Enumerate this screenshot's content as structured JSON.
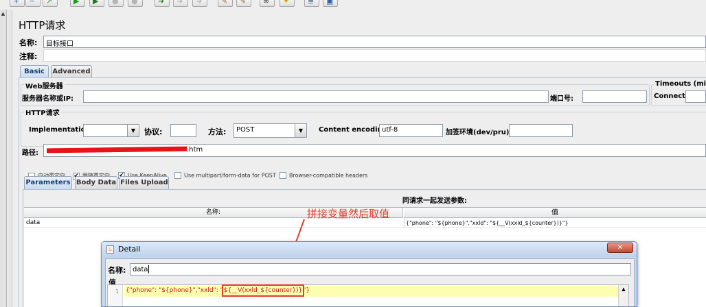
{
  "toolbar": {
    "buttons": [
      {
        "icon": "plus-icon",
        "glyph": "+",
        "color": "#2a5fa8"
      },
      {
        "icon": "minus-icon",
        "glyph": "−",
        "color": "#2a5fa8"
      },
      {
        "icon": "expand-icon",
        "glyph": "↗",
        "color": "#2a8a2a"
      },
      {
        "icon": "start-icon",
        "glyph": "▶",
        "color": "#1f9a1f"
      },
      {
        "icon": "start-no-pause-icon",
        "glyph": "▶",
        "color": "#1f7a1f"
      },
      {
        "icon": "stop-icon",
        "glyph": "●",
        "color": "#b5b5b5"
      },
      {
        "icon": "shutdown-icon",
        "glyph": "●",
        "color": "#b5b5b5"
      },
      {
        "icon": "remote-start-icon",
        "glyph": "➜",
        "color": "#2a8a2a"
      },
      {
        "icon": "remote-stop-icon",
        "glyph": "➜",
        "color": "#b5b5b5"
      },
      {
        "icon": "remote-exit-icon",
        "glyph": "➜",
        "color": "#b5b5b5"
      },
      {
        "icon": "clear-icon",
        "glyph": "✎",
        "color": "#b06020"
      },
      {
        "icon": "clear-all-icon",
        "glyph": "✎",
        "color": "#8a5a30"
      },
      {
        "icon": "search-binoculars-icon",
        "glyph": "∞",
        "color": "#222222"
      },
      {
        "icon": "reset-search-icon",
        "glyph": "✦",
        "color": "#d8a400"
      },
      {
        "icon": "function-helper-icon",
        "glyph": "≣",
        "color": "#3c5f8a"
      },
      {
        "icon": "help-icon",
        "glyph": "▣",
        "color": "#2a5fa8"
      }
    ]
  },
  "sidebar": {
    "scroll_up_glyph": "▲"
  },
  "panel": {
    "title": "HTTP请求",
    "name_label": "名称:",
    "name_value": "目标接口",
    "comment_label": "注释:",
    "comment_value": ""
  },
  "tabs": {
    "basic": "Basic",
    "advanced": "Advanced"
  },
  "web_server": {
    "section_title": "Web服务器",
    "server_label": "服务器名称或IP:",
    "server_value": "",
    "port_label": "端口号:",
    "port_value": ""
  },
  "timeouts": {
    "section_title": "Timeouts (millis",
    "connect_label": "Connect:",
    "connect_value": ""
  },
  "http_request": {
    "section_title": "HTTP请求",
    "implementation_label": "Implementation:",
    "implementation_value": "",
    "protocol_label": "协议:",
    "protocol_value": "",
    "method_label": "方法:",
    "method_value": "POST",
    "encoding_label": "Content encoding:",
    "encoding_value": "utf-8",
    "sign_env_label": "加签环境(dev/pru):",
    "sign_env_value": "",
    "path_label": "路径:",
    "path_suffix": ".htm"
  },
  "checkboxes": [
    {
      "label": "自动重定向",
      "checked": false
    },
    {
      "label": "跟随重定向",
      "checked": true
    },
    {
      "label": "Use KeepAlive",
      "checked": true
    },
    {
      "label": "Use multipart/form-data for POST",
      "checked": false
    },
    {
      "label": "Browser-compatible headers",
      "checked": false
    }
  ],
  "subtabs": {
    "parameters": "Parameters",
    "body_data": "Body Data",
    "files_upload": "Files Upload"
  },
  "params_table": {
    "caption": "同请求一起发送参数:",
    "col_name": "名称:",
    "col_value": "值",
    "rows": [
      {
        "name": "data",
        "value": "{\"phone\": \"${phone}\",\"xxld\": \"${__V(xxld_${counter})}\"}"
      }
    ]
  },
  "annotation": {
    "text": "拼接变量然后取值",
    "color": "#e03c2c"
  },
  "detail_dialog": {
    "title": "Detail",
    "close_glyph": "✕",
    "name_label": "名称:",
    "name_value": "data",
    "value_label": "值",
    "line_number": "1",
    "code_prefix": "{\"phone\": \"${phone}\",\"xxld\": \"",
    "code_highlight": "${__V(xxld_${counter})}",
    "code_suffix": "\"}"
  }
}
